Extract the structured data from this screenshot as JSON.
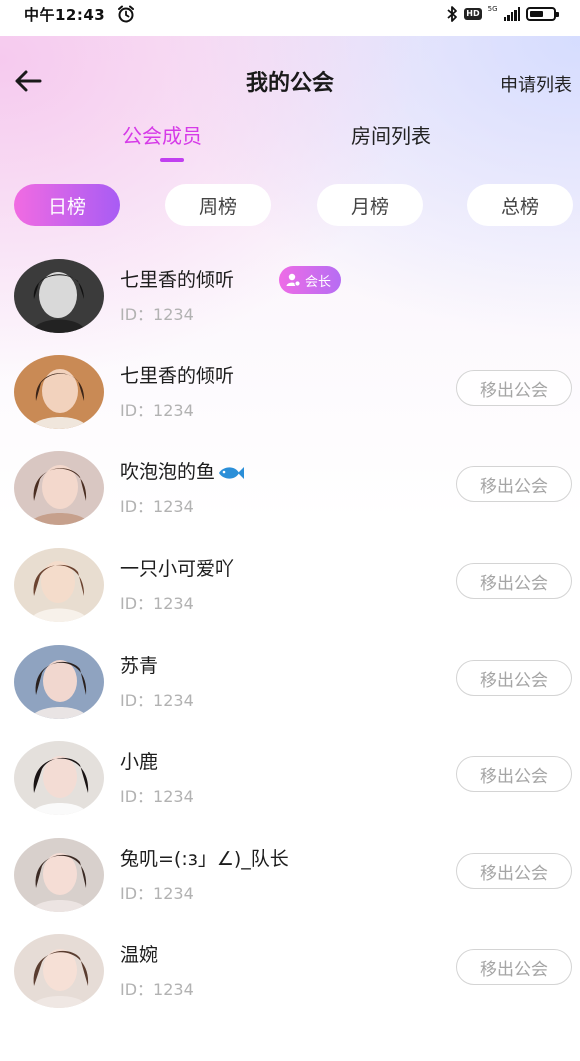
{
  "status_bar": {
    "time": "中午12:43",
    "hd_label": "HD",
    "network_label": "5G",
    "battery_level": 0.6
  },
  "header": {
    "title": "我的公会",
    "back_icon": "arrow-left-icon",
    "apply_list_label": "申请列表"
  },
  "tabs": [
    {
      "label": "公会成员",
      "active": true
    },
    {
      "label": "房间列表",
      "active": false
    }
  ],
  "rank_filters": [
    {
      "label": "日榜",
      "active": true
    },
    {
      "label": "周榜",
      "active": false
    },
    {
      "label": "月榜",
      "active": false
    },
    {
      "label": "总榜",
      "active": false
    }
  ],
  "colors": {
    "accent": "#d63ae8",
    "pill_gradient_start": "#f16be2",
    "pill_gradient_end": "#a85cf4"
  },
  "members": [
    {
      "name": "七里香的倾听",
      "id_text": "ID：1234",
      "badge": "会长"
    },
    {
      "name": "七里香的倾听",
      "id_text": "ID：1234",
      "action": "移出公会"
    },
    {
      "name": "吹泡泡的鱼",
      "name_icon": "fish-icon",
      "id_text": "ID：1234",
      "action": "移出公会"
    },
    {
      "name": "一只小可爱吖",
      "id_text": "ID：1234",
      "action": "移出公会"
    },
    {
      "name": "苏青",
      "id_text": "ID：1234",
      "action": "移出公会"
    },
    {
      "name": "小鹿",
      "id_text": "ID：1234",
      "action": "移出公会"
    },
    {
      "name": "兔叽=(:з」∠)_队长",
      "id_text": "ID：1234",
      "action": "移出公会"
    },
    {
      "name": "温婉",
      "id_text": "ID：1234",
      "action": "移出公会"
    }
  ]
}
